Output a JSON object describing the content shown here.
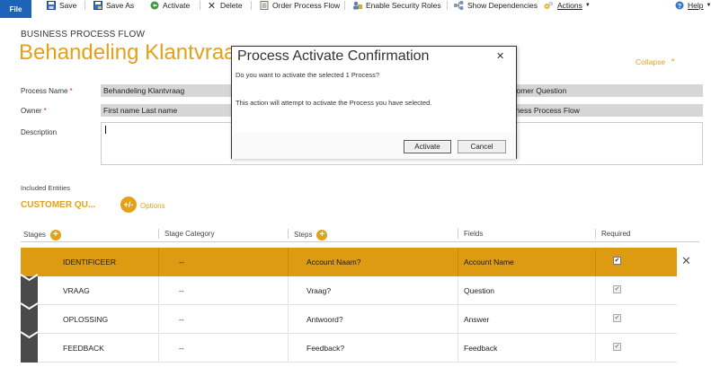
{
  "ribbon": {
    "file": "File",
    "items": [
      {
        "label": "Save",
        "icon": "save-icon"
      },
      {
        "label": "Save As",
        "icon": "save-as-icon"
      },
      {
        "label": "Activate",
        "icon": "activate-icon"
      },
      {
        "label": "Delete",
        "icon": "delete-icon"
      },
      {
        "label": "Order Process Flow",
        "icon": "order-process-flow-icon"
      },
      {
        "label": "Enable Security Roles",
        "icon": "security-roles-icon"
      },
      {
        "label": "Show Dependencies",
        "icon": "dependencies-icon"
      },
      {
        "label": "Actions",
        "icon": "actions-icon"
      }
    ],
    "help": "Help"
  },
  "header": {
    "type_label": "BUSINESS PROCESS FLOW",
    "title": "Behandeling Klantvraag",
    "collapse": "Collapse"
  },
  "form": {
    "process_name_label": "Process Name",
    "process_name_value": "Behandeling Klantvraag",
    "owner_label": "Owner",
    "owner_value": "First name Last name",
    "description_label": "Description",
    "right_value_1": "Customer Question",
    "right_value_2": "Business Process Flow"
  },
  "entities": {
    "label": "Included Entities",
    "tab": "CUSTOMER QU...",
    "options": "Options"
  },
  "grid": {
    "columns": [
      "Stages",
      "Stage Category",
      "Steps",
      "Fields",
      "Required"
    ],
    "rows": [
      {
        "stage": "IDENTIFICEER",
        "category": "--",
        "step": "Account Naam?",
        "field": "Account Name",
        "required": true,
        "active": true
      },
      {
        "stage": "VRAAG",
        "category": "--",
        "step": "Vraag?",
        "field": "Question",
        "required": true,
        "active": false
      },
      {
        "stage": "OPLOSSING",
        "category": "--",
        "step": "Antwoord?",
        "field": "Answer",
        "required": true,
        "active": false
      },
      {
        "stage": "FEEDBACK",
        "category": "--",
        "step": "Feedback?",
        "field": "Feedback",
        "required": true,
        "active": false
      }
    ]
  },
  "dialog": {
    "title": "Process Activate Confirmation",
    "question": "Do you want to activate the selected 1 Process?",
    "message": "This action will attempt to activate the Process you have selected.",
    "activate": "Activate",
    "cancel": "Cancel"
  },
  "colors": {
    "accent": "#e3a11a",
    "active_row": "#dc9b10",
    "file_button": "#1d63b8"
  }
}
